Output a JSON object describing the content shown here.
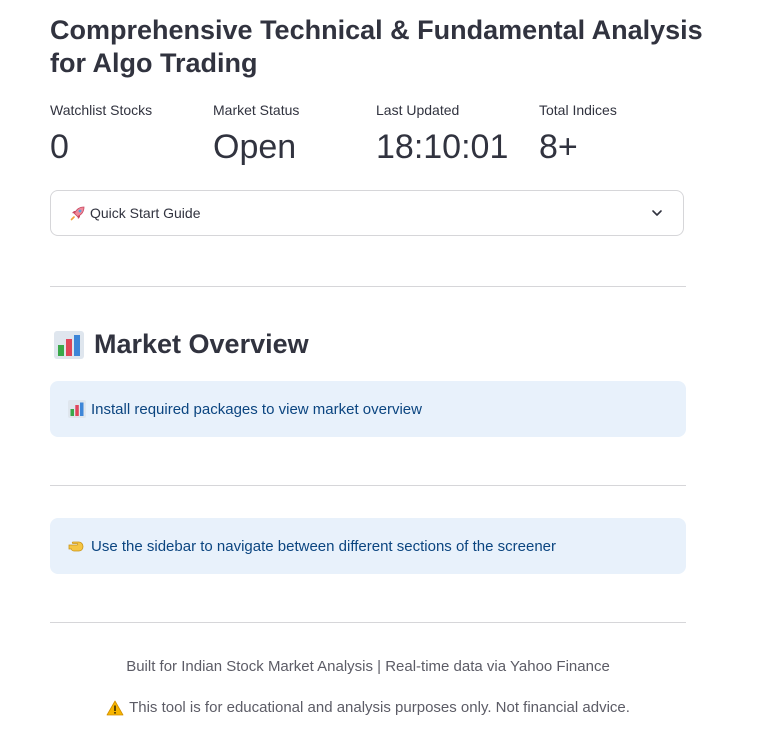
{
  "header": {
    "title": "Comprehensive Technical & Fundamental Analysis for Algo Trading"
  },
  "metrics": [
    {
      "label": "Watchlist Stocks",
      "value": "0"
    },
    {
      "label": "Market Status",
      "value": "Open"
    },
    {
      "label": "Last Updated",
      "value": "18:10:01"
    },
    {
      "label": "Total Indices",
      "value": "8+"
    }
  ],
  "quick_start": {
    "label": "Quick Start Guide",
    "icon": "rocket-icon",
    "expanded": false
  },
  "market_overview": {
    "heading": "Market Overview",
    "icon": "bar-chart-icon",
    "info_text": "Install required packages to view market overview"
  },
  "sidebar_hint": {
    "icon": "pointing-hand-icon",
    "text": "Use the sidebar to navigate between different sections of the screener"
  },
  "footer": {
    "line1": "Built for Indian Stock Market Analysis | Real-time data via Yahoo Finance",
    "line2": "This tool is for educational and analysis purposes only. Not financial advice.",
    "warning_icon": "warning-icon"
  },
  "colors": {
    "text": "#31333f",
    "info_bg": "#e8f1fb",
    "info_text": "#0b4580",
    "divider": "#d6d6d9",
    "muted": "#5c5c66"
  }
}
